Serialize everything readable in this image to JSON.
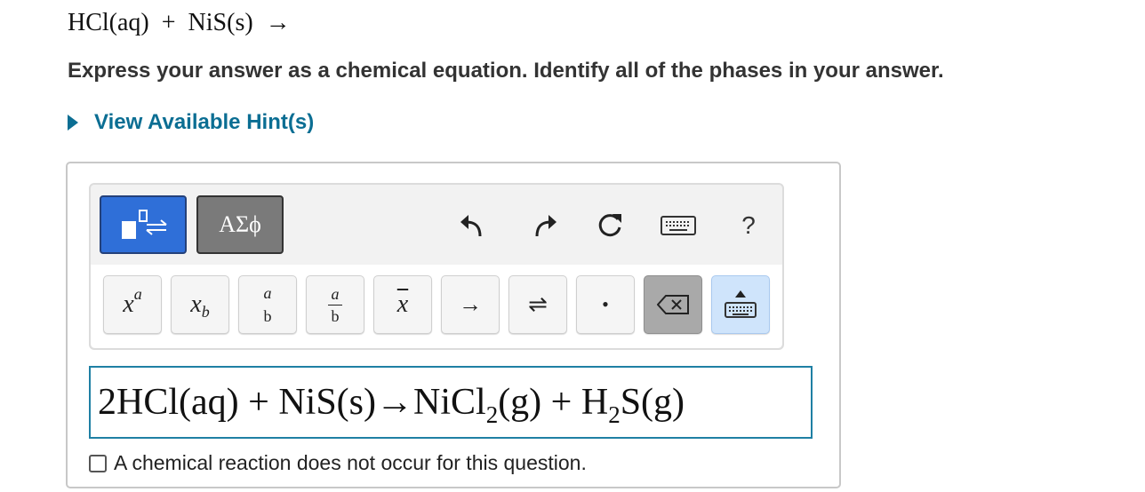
{
  "question": {
    "reactants": "HCl(aq)  +  NiS(s)  →"
  },
  "instructions": "Express your answer as a chemical equation. Identify all of the phases in your answer.",
  "hint": {
    "label": "View Available Hint(s)"
  },
  "toolbar": {
    "greek_mode_label": "ΑΣϕ",
    "help_label": "?",
    "keys": {
      "superscript_base": "x",
      "superscript_exp": "a",
      "subscript_base": "x",
      "subscript_sub": "b",
      "stacked_top": "a",
      "stacked_bottom": "b",
      "fraction_num": "a",
      "fraction_den": "b",
      "overline": "x",
      "yield_arrow": "→",
      "equilibrium_arrow": "⇌",
      "dot": "•"
    }
  },
  "answer": {
    "coef_reactant": "2HCl(aq) + NiS(s)",
    "arrow": "→",
    "product1_base": "NiCl",
    "product1_sub": "2",
    "product1_phase": "(g) + H",
    "product2_sub": "2",
    "product2_rest": "S(g)"
  },
  "no_reaction": {
    "label": "A chemical reaction does not occur for this question.",
    "checked": false
  },
  "colors": {
    "hint_link": "#0b6e93",
    "answer_border": "#1f80a4",
    "chem_mode_active": "#2f6fd8",
    "keyboard_toggle": "#cfe4fb"
  },
  "icons": [
    "chem-mode-icon",
    "undo-icon",
    "redo-icon",
    "reset-icon",
    "keyboard-icon",
    "help-icon",
    "backspace-icon",
    "keyboard-toggle-icon",
    "hint-expand-arrow-icon"
  ]
}
